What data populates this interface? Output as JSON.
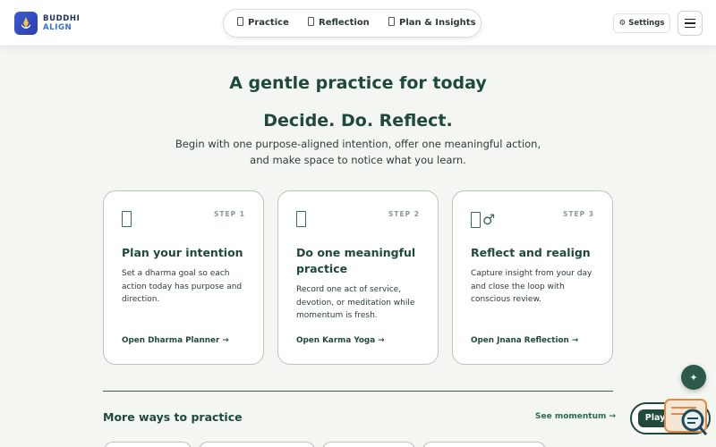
{
  "brand": {
    "line1": "BUDDHI",
    "line2": "ALIGN"
  },
  "nav": [
    {
      "label": "Practice",
      "icon": "practice-icon"
    },
    {
      "label": "Reflection",
      "icon": "reflection-icon"
    },
    {
      "label": "Plan & Insights",
      "icon": "plan-icon"
    }
  ],
  "header": {
    "settings_label": "Settings",
    "settings_icon": "gear-icon",
    "menu_icon": "hamburger-icon"
  },
  "hero": {
    "title": "A gentle practice for today",
    "subtitle": "Decide. Do. Reflect.",
    "description": "Begin with one purpose-aligned intention, offer one meaningful action, and make space to notice what you learn."
  },
  "steps": [
    {
      "step": "STEP 1",
      "title": "Plan your intention",
      "description": "Set a dharma goal so each action today has purpose and direction.",
      "link": "Open Dharma Planner →"
    },
    {
      "step": "STEP 2",
      "title": "Do one meaningful practice",
      "description": "Record one act of service, devotion, or meditation while momentum is fresh.",
      "link": "Open Karma Yoga →"
    },
    {
      "step": "STEP 3",
      "title": "Reflect and realign",
      "description": "Capture insight from your day and close the loop with conscious review.",
      "link": "Open Jnana Reflection →"
    }
  ],
  "more": {
    "title": "More ways to practice",
    "see_link": "See momentum →"
  },
  "player": {
    "play_label": "Play"
  },
  "colors": {
    "accent": "#1f4a3a",
    "brand_blue": "#2f6fe0",
    "background": "#f3f6f1"
  }
}
